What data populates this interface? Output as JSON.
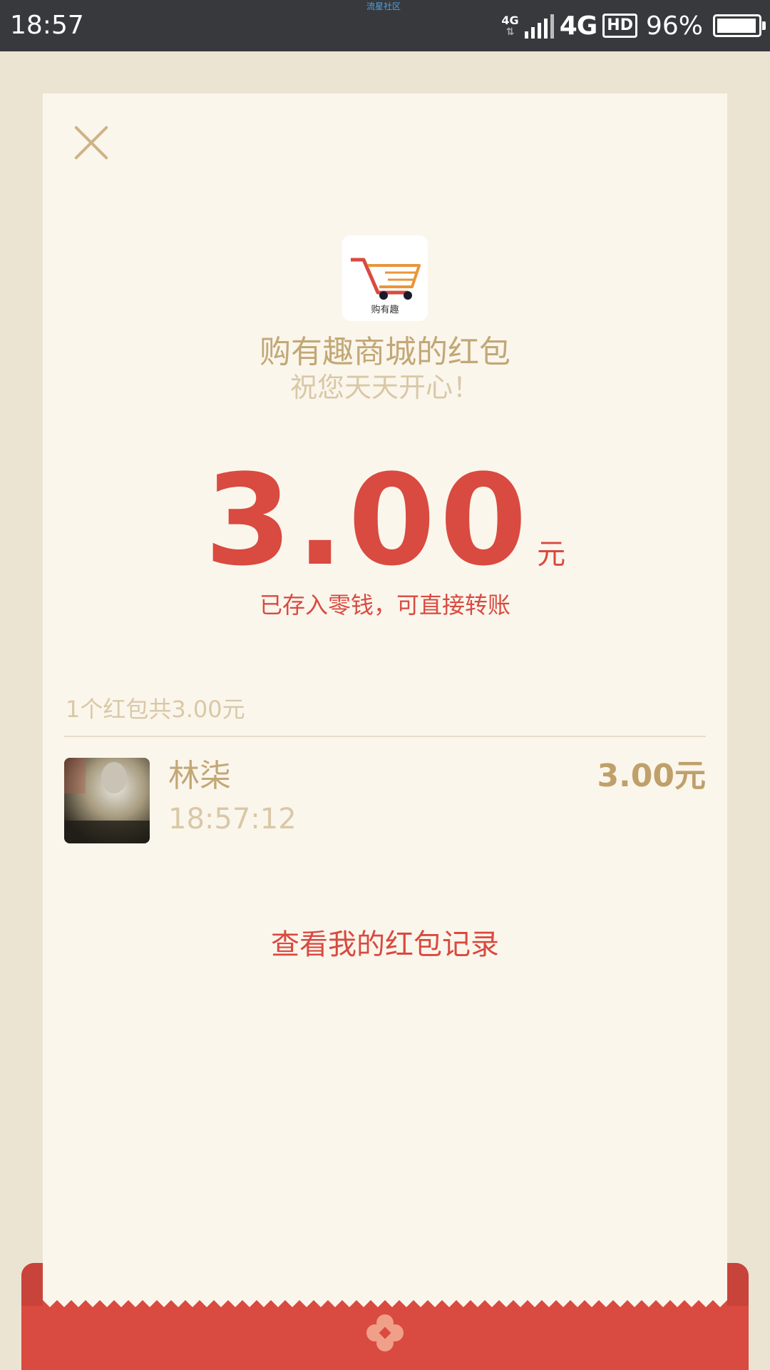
{
  "status_bar": {
    "time": "18:57",
    "carrier_label": "流星社区",
    "network_small": "4G",
    "network_big": "4G",
    "hd_label": "HD",
    "battery_percent": "96%"
  },
  "red_packet": {
    "logo_caption": "购有趣",
    "title": "购有趣商城的红包",
    "subtitle": "祝您天天开心！",
    "amount": "3.00",
    "unit": "元",
    "note": "已存入零钱，可直接转账",
    "summary": "1个红包共3.00元",
    "records": [
      {
        "name": "林柒",
        "time": "18:57:12",
        "amount": "3.00元"
      }
    ],
    "history_link": "查看我的红包记录"
  },
  "colors": {
    "accent_red": "#d94a40",
    "gold_text": "#c2a876",
    "light_gold_text": "#d9c8a6",
    "card_bg": "#fbf6ec",
    "page_bg": "#ece4d3",
    "status_bar_bg": "#38393d"
  },
  "icons": {
    "close": "close-icon",
    "logo": "shopping-cart-logo-icon",
    "flower": "flower-icon"
  }
}
